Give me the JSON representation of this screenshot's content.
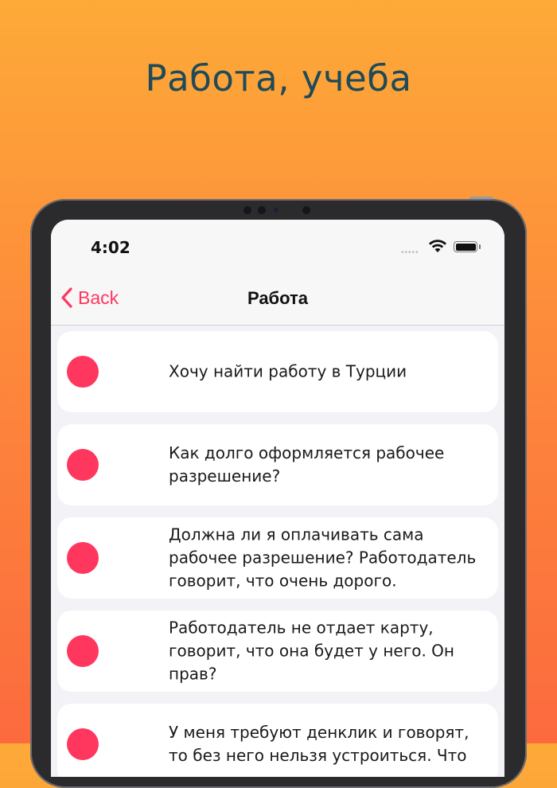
{
  "promo": {
    "title": "Работа, учеба"
  },
  "status_bar": {
    "time": "4:02",
    "signal_icon": "wifi-icon",
    "battery_icon": "battery-icon"
  },
  "nav": {
    "back_label": "Back",
    "title": "Работа"
  },
  "colors": {
    "accent": "#FF375F",
    "background_top": "#FDAA38",
    "background_bottom": "#FC6A3E",
    "title_color": "#1F4A57"
  },
  "questions": [
    {
      "text": "Хочу найти работу в Турции"
    },
    {
      "text": "Как долго оформляется рабочее разрешение?"
    },
    {
      "text": "Должна ли я оплачивать сама рабочее разрешение? Работодатель говорит, что очень дорого."
    },
    {
      "text": "Работодатель не отдает карту, говорит, что она будет у него. Он прав?"
    },
    {
      "text": "У меня требуют денклик и говорят, то без него нельзя устроиться. Что"
    }
  ]
}
